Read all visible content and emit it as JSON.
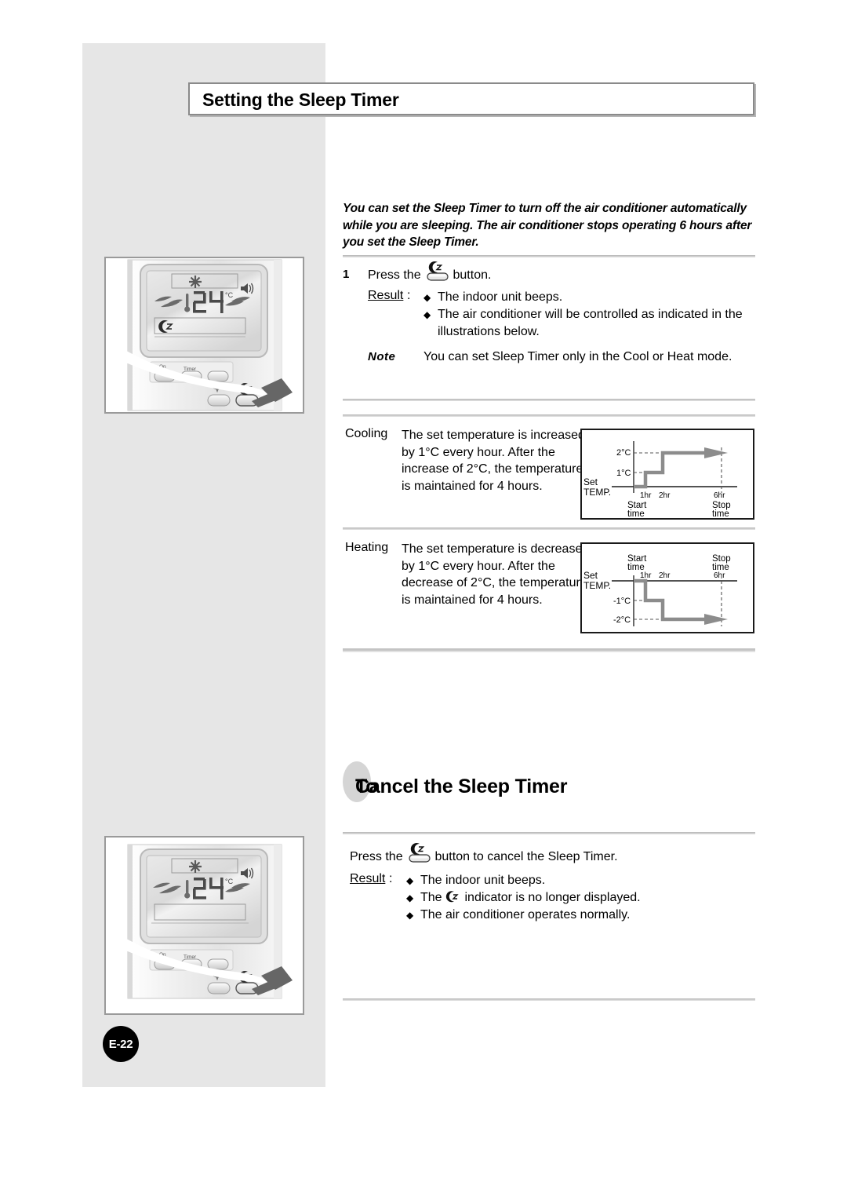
{
  "page": {
    "badge": "E-22",
    "title": "Setting the Sleep Timer",
    "cancel_title_lead": "To",
    "cancel_title_rest": "Cancel the Sleep Timer"
  },
  "intro": "You can set the Sleep Timer to turn off the air conditioner automatically while you are sleeping. The air conditioner stops operating 6 hours after you set the Sleep Timer.",
  "step1": {
    "number": "1",
    "text_before": "Press the",
    "text_after": "button.",
    "result_label": "Result",
    "colon": ":",
    "bullets": [
      "The indoor unit beeps.",
      "The air conditioner will be controlled as indicated in the illustrations below."
    ],
    "note_label": "Note",
    "note_text": "You can set Sleep Timer only in the Cool or Heat mode."
  },
  "modes": [
    {
      "name": "Cooling",
      "description": "The set temperature is increased by 1°C every hour. After the increase of 2°C, the temperature is maintained for 4 hours."
    },
    {
      "name": "Heating",
      "description": "The set temperature is decreased by 1°C every hour. After the decrease of 2°C, the temperature is maintained for 4 hours."
    }
  ],
  "cancel": {
    "text_before": "Press the",
    "text_after": "button to cancel the Sleep Timer.",
    "result_label": "Result",
    "colon": ":",
    "bullet1": "The indoor unit beeps.",
    "bullet2_before": "The",
    "bullet2_after": "indicator is no longer displayed.",
    "bullet3": "The air conditioner operates normally."
  },
  "remote": {
    "display_temperature": "24",
    "display_degree": "°C",
    "button_on_timer_line1": "On",
    "button_on_timer_line2": "Timer",
    "button_timer": "Timer"
  },
  "chart_data": [
    {
      "type": "line",
      "title": "Cooling",
      "axis_label": "Set TEMP.",
      "ylabel_lines": [
        "Set",
        "TEMP."
      ],
      "x": [
        0,
        1,
        1,
        2,
        2,
        6
      ],
      "values": [
        0,
        0,
        1,
        1,
        2,
        2
      ],
      "ytick_labels": [
        "2°C",
        "1°C"
      ],
      "yticks": [
        2,
        1
      ],
      "xtick_labels": [
        "1hr",
        "2hr",
        "6hr"
      ],
      "xticks": [
        1,
        2,
        6
      ],
      "start_label_lines": [
        "Start",
        "time"
      ],
      "stop_label_lines": [
        "Stop",
        "time"
      ],
      "grid": "dashed-guides",
      "arrow": "right",
      "ylim": [
        0,
        2
      ],
      "xlim": [
        0,
        7
      ]
    },
    {
      "type": "line",
      "title": "Heating",
      "axis_label": "Set TEMP.",
      "ylabel_lines": [
        "Set",
        "TEMP."
      ],
      "x": [
        0,
        1,
        1,
        2,
        2,
        6
      ],
      "values": [
        0,
        0,
        -1,
        -1,
        -2,
        -2
      ],
      "ytick_labels": [
        "-1°C",
        "-2°C"
      ],
      "yticks": [
        -1,
        -2
      ],
      "xtick_labels": [
        "1hr",
        "2hr",
        "6hr"
      ],
      "xticks": [
        1,
        2,
        6
      ],
      "start_label_lines": [
        "Start",
        "time"
      ],
      "stop_label_lines": [
        "Stop",
        "time"
      ],
      "grid": "dashed-guides",
      "arrow": "right",
      "ylim": [
        -2,
        0
      ],
      "xlim": [
        0,
        7
      ]
    }
  ],
  "colors": {
    "panel_gray": "#e6e6e6",
    "rule_gray": "#bdbdbd",
    "chart_line": "#8c8c8c",
    "badge_bg": "#000000"
  }
}
